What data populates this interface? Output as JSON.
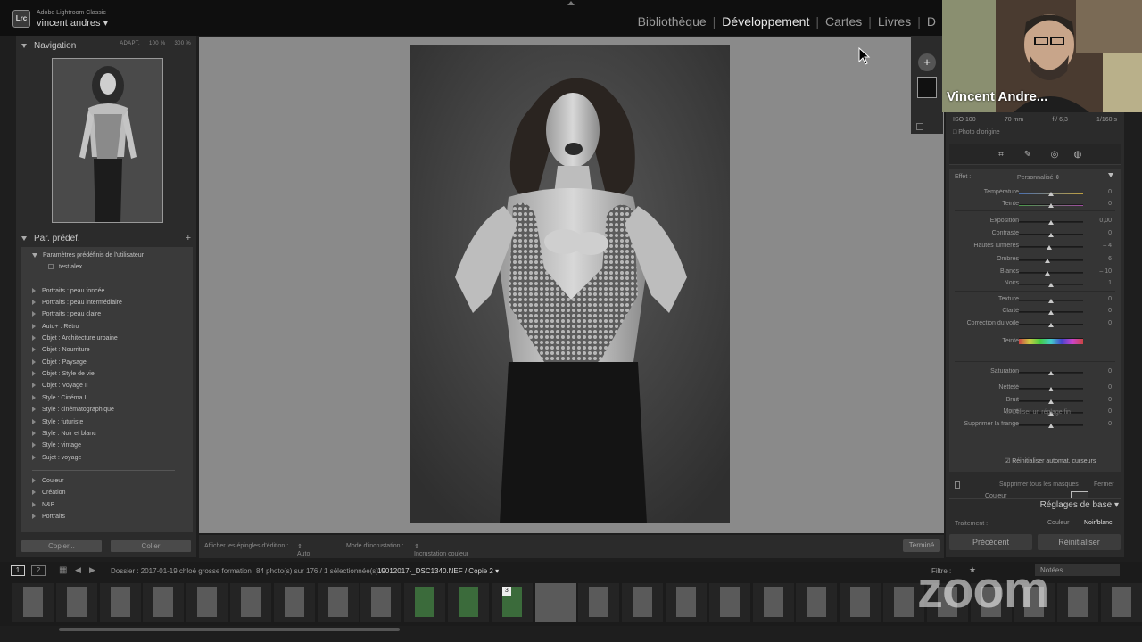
{
  "app": {
    "logo": "Lrc",
    "name": "Adobe Lightroom Classic",
    "user": "vincent andres"
  },
  "modules": [
    "Bibliothèque",
    "Développement",
    "Cartes",
    "Livres",
    "D"
  ],
  "navigator": {
    "title": "Navigation",
    "zoom_options": [
      "ADAPT.",
      "100 %",
      "300 %"
    ]
  },
  "presets": {
    "title": "Par. prédef.",
    "user_group": "Paramètres prédéfinis de l'utilisateur",
    "user_item": "test alex",
    "groups": [
      "Portraits : peau foncée",
      "Portraits : peau intermédiaire",
      "Portraits : peau claire",
      "Auto+ : Rétro",
      "Objet : Architecture urbaine",
      "Objet : Nourriture",
      "Objet : Paysage",
      "Objet : Style de vie",
      "Objet : Voyage II",
      "Style : Cinéma II",
      "Style : cinématographique",
      "Style : futuriste",
      "Style : Noir et blanc",
      "Style : vintage",
      "Sujet : voyage"
    ],
    "extra_groups": [
      "Couleur",
      "Création",
      "N&B",
      "Portraits"
    ],
    "copy_label": "Copier...",
    "paste_label": "Coller"
  },
  "toolbar": {
    "pins_label": "Afficher les épingles d'édition :",
    "pins_value": "Auto",
    "overlay_label": "Mode d'incrustation :",
    "overlay_value": "Incrustation couleur",
    "done_label": "Terminé"
  },
  "right_panel": {
    "meta": [
      "ISO 100",
      "70 mm",
      "f / 6,3",
      "1/160 s"
    ],
    "original_photo": "Photo d'origine",
    "effect_label": "Effet :",
    "effect_value": "Personnalisé",
    "sliders": [
      {
        "label": "Température",
        "value": "0"
      },
      {
        "label": "Teinte",
        "value": "0"
      },
      {
        "label": "Exposition",
        "value": "0,00"
      },
      {
        "label": "Contraste",
        "value": "0"
      },
      {
        "label": "Hautes lumières",
        "value": "– 4"
      },
      {
        "label": "Ombres",
        "value": "– 6"
      },
      {
        "label": "Blancs",
        "value": "– 10"
      },
      {
        "label": "Noirs",
        "value": "1"
      },
      {
        "label": "Texture",
        "value": "0"
      },
      {
        "label": "Clarté",
        "value": "0"
      },
      {
        "label": "Correction du voile",
        "value": "0"
      },
      {
        "label": "Teinte",
        "value": ""
      },
      {
        "label": "Saturation",
        "value": "0"
      },
      {
        "label": "Netteté",
        "value": "0"
      },
      {
        "label": "Bruit",
        "value": "0"
      },
      {
        "label": "Moiré",
        "value": "0"
      },
      {
        "label": "Supprimer la frange",
        "value": "0"
      }
    ],
    "fine_tune_label": "Utiliser un réglage fin",
    "color_label": "Couleur",
    "auto_reset_label": "Réinitialiser automat. curseurs",
    "remove_masks_label": "Supprimer tous les masques",
    "close_label": "Fermer",
    "basic_section": "Réglages de base",
    "treatment_label": "Traitement :",
    "treatment_color": "Couleur",
    "treatment_bw": "Noir/blanc",
    "previous_label": "Précédent",
    "reset_label": "Réinitialiser"
  },
  "filmstrip": {
    "page1": "1",
    "page2": "2",
    "folder": "Dossier : 2017-01-19 chloé grosse formation",
    "count": "84 photo(s) sur 176 / 1 sélectionnée(s) /",
    "filename": "19012017-_DSC1340.NEF / Copie 2",
    "filter_label": "Filtre :",
    "notes_label": "Notées",
    "badge": "3"
  },
  "video": {
    "participant": "Vincent Andre...",
    "watermark": "zoom"
  }
}
